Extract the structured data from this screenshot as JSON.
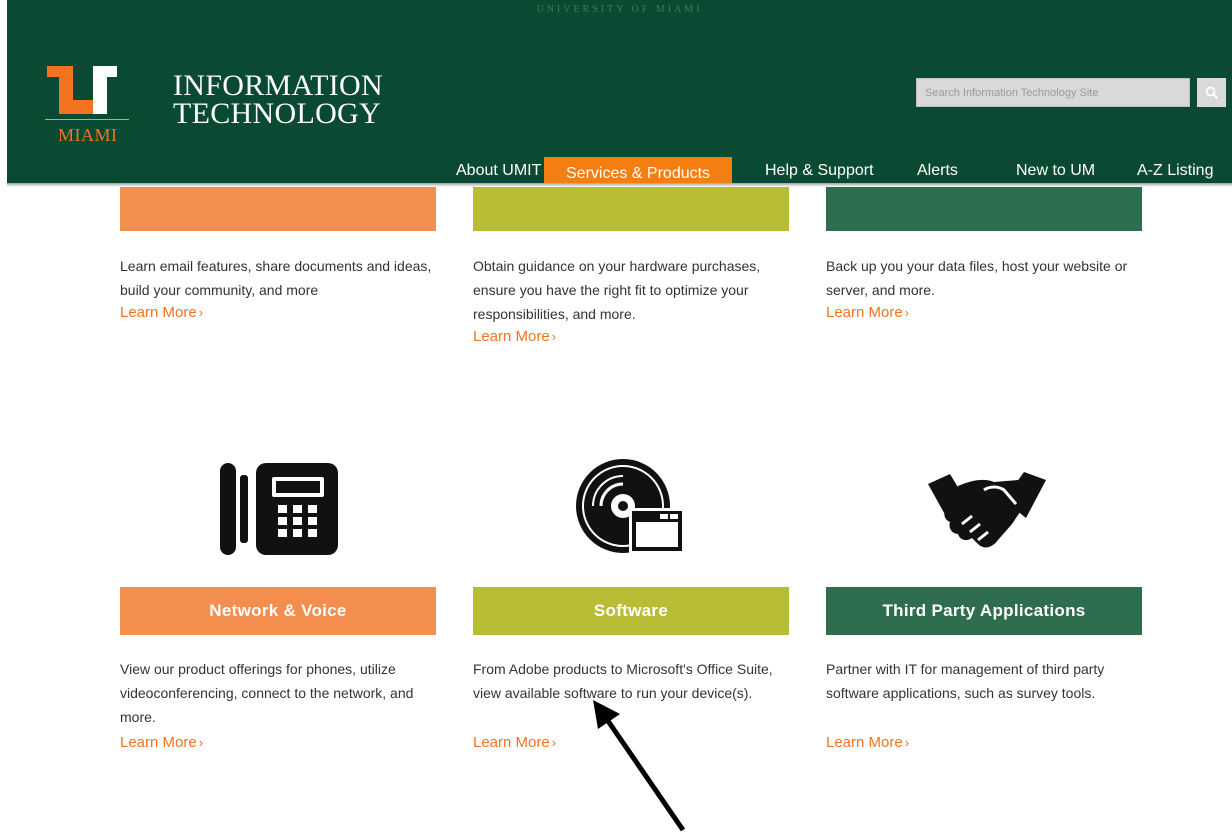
{
  "header": {
    "university_label": "UNIVERSITY OF MIAMI",
    "logo_text": "MIAMI",
    "site_title_line1": "INFORMATION",
    "site_title_line2": "TECHNOLOGY",
    "search_placeholder": "Search Information Technology Site",
    "search_icon": "magnifier-icon"
  },
  "nav": {
    "items": [
      {
        "label": "About UMIT"
      },
      {
        "label": "Services & Products",
        "active": true
      },
      {
        "label": "Help & Support"
      },
      {
        "label": "Alerts"
      },
      {
        "label": "New to UM"
      },
      {
        "label": "A-Z Listing"
      }
    ]
  },
  "top_cards": [
    {
      "desc": "Learn email features, share documents and ideas, build your community, and more",
      "link": "Learn More"
    },
    {
      "desc": "Obtain guidance on your hardware purchases, ensure you have the right fit to optimize your responsibilities, and more.",
      "link": "Learn More"
    },
    {
      "desc": "Back up you your data files, host your website or server, and more.",
      "link": "Learn More"
    }
  ],
  "cards": [
    {
      "title": "Network & Voice",
      "icon": "desk-phone-icon",
      "desc": "View our product offerings for phones, utilize videoconferencing, connect to the network, and more.",
      "link": "Learn More"
    },
    {
      "title": "Software",
      "icon": "software-disc-icon",
      "desc": "From Adobe products to Microsoft's Office Suite, view available software to run your device(s).",
      "link": "Learn More"
    },
    {
      "title": "Third Party Applications",
      "icon": "handshake-icon",
      "desc": "Partner with IT for management of third party software applications, such as survey tools.",
      "link": "Learn More"
    }
  ],
  "colors": {
    "header_green": "#0a4a32",
    "accent_orange": "#f47f10",
    "bar_orange": "#f48e4e",
    "bar_olive": "#b8bd36",
    "bar_green": "#2f6d4f",
    "link_orange": "#f47321"
  },
  "annotation": "arrow-pointer"
}
